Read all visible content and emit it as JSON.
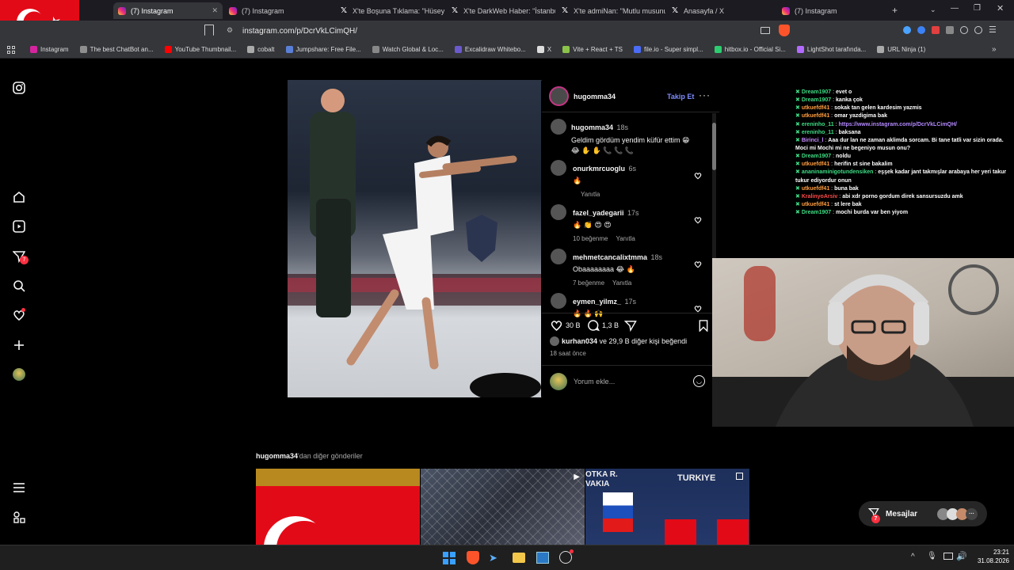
{
  "browser": {
    "tabs": [
      {
        "label": "(7) Instagram",
        "icon": "instagram-icon",
        "active": true
      },
      {
        "label": "(7) Instagram",
        "icon": "instagram-icon",
        "active": false
      },
      {
        "label": "X'te Boşuna Tıklama: \"Hüseyin",
        "icon": "x-icon",
        "active": false
      },
      {
        "label": "X'te DarkWeb Haber: \"İstanbul",
        "icon": "x-icon",
        "active": false
      },
      {
        "label": "X'te admiNan: \"Mutlu musunuz",
        "icon": "x-icon",
        "active": false
      },
      {
        "label": "Anasayfa / X",
        "icon": "x-icon",
        "active": false
      },
      {
        "label": "(7) Instagram",
        "icon": "instagram-icon",
        "active": false
      }
    ],
    "url": "instagram.com/p/DcrVkLCimQH/",
    "bookmarks": [
      "Instagram",
      "The best ChatBot an...",
      "YouTube Thumbnail...",
      "cobalt",
      "Jumpshare: Free File...",
      "Watch Global & Loc...",
      "Excalidraw Whitebo...",
      "X",
      "Vite + React + TS",
      "file.io - Super simpl...",
      "hitbox.io - Official Si...",
      "LightShot tarafında...",
      "URL Ninja (1)"
    ]
  },
  "nav": {
    "notifications_badge": "7"
  },
  "post": {
    "author": "hugomma34",
    "follow_label": "Takip Et",
    "caption_author": "hugomma34",
    "caption_time": "18s",
    "caption_text": "Geldim gördüm yendim küfür ettim 😁",
    "caption_emojis": "😂 ✋ ✋ 📞 📞 📞",
    "comments": [
      {
        "user": "onurkmrcuoglu",
        "time": "6s",
        "text": "🔥",
        "likes": "",
        "reply": "Yanıtla"
      },
      {
        "user": "fazel_yadegarii",
        "time": "17s",
        "text": "🔥 👏 😍 😍",
        "likes": "10 beğenme",
        "reply": "Yanıtla"
      },
      {
        "user": "mehmetcancalixtmma",
        "time": "18s",
        "text": "Obaaaaaaaa 😂 🔥",
        "likes": "7 beğenme",
        "reply": "Yanıtla"
      },
      {
        "user": "eymen_yilmz_",
        "time": "17s",
        "text": "🔥 🔥 🙌",
        "likes": "",
        "reply": ""
      }
    ],
    "like_count": "30 B",
    "comment_count": "1,3 B",
    "liked_by_user": "kurhan034",
    "liked_by_rest": "ve 29,9 B diğer kişi beğendi",
    "time_ago": "18 saat önce",
    "comment_placeholder": "Yorum ekle..."
  },
  "more_posts": {
    "user": "hugomma34",
    "suffix": "'dan diğer gönderiler",
    "thumb2_text": "OTKA R. VAKIA",
    "thumb3_text": "TURKIYE"
  },
  "chat": [
    {
      "user": "Dream1907",
      "msg": "evet o",
      "color": "#3ddc84"
    },
    {
      "user": "Dream1907",
      "msg": "kanka çok",
      "color": "#3ddc84"
    },
    {
      "user": "utkuefdf41",
      "msg": "sokak tan gelen kardesim yazmis",
      "color": "#ff9d3d"
    },
    {
      "user": "utkuefdf41",
      "msg": "omar yazdigima bak",
      "color": "#ff9d3d"
    },
    {
      "user": "ereninho_11",
      "msg": "https://www.instagram.com/p/DcrVkLCimQH/",
      "color": "#3ddc84",
      "link": true
    },
    {
      "user": "ereninho_11",
      "msg": "baksana",
      "color": "#3ddc84"
    },
    {
      "user": "Birinci_l",
      "msg": "Aaa dur lan ne zaman aklimda sorcam. Bi tane tatli var sizin orada. Moci mi Mochi mi ne begeniyo musun onu?",
      "color": "#c58bff"
    },
    {
      "user": "Dream1907",
      "msg": "noldu",
      "color": "#3ddc84"
    },
    {
      "user": "utkuefdf41",
      "msg": "herifin st sine bakalim",
      "color": "#ff9d3d"
    },
    {
      "user": "ananinaminigotundensiken",
      "msg": "eşşek kadar jant takmışlar arabaya her yeri takur tukur ediyordur onun",
      "color": "#3ddc84"
    },
    {
      "user": "utkuefdf41",
      "msg": "buna bak",
      "color": "#ff9d3d"
    },
    {
      "user": "KralinyoArsiv",
      "msg": "abi xdr porno gordum direk sansursuzdu amk",
      "color": "#ff4a4a"
    },
    {
      "user": "utkuefdf41",
      "msg": "st lere bak",
      "color": "#ff9d3d"
    },
    {
      "user": "Dream1907",
      "msg": "mochi burda var ben yiyom",
      "color": "#3ddc84"
    }
  ],
  "messages_button": {
    "label": "Mesajlar",
    "badge": "7"
  },
  "taskbar": {
    "time": "23:21",
    "date": "31.08.2026"
  }
}
